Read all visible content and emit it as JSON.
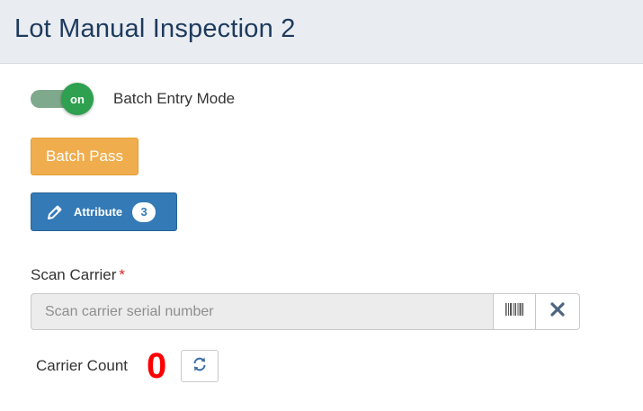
{
  "header": {
    "title": "Lot Manual Inspection 2"
  },
  "batch_mode": {
    "toggle_state": "on",
    "label": "Batch Entry Mode"
  },
  "actions": {
    "batch_pass_label": "Batch Pass",
    "attribute_label": "Attribute",
    "attribute_count": "3"
  },
  "scan": {
    "label": "Scan Carrier",
    "required_marker": "*",
    "value": "",
    "placeholder": "Scan carrier serial number",
    "barcode_icon": "barcode-icon",
    "clear_icon": "close-icon"
  },
  "carrier_count": {
    "label": "Carrier Count",
    "value": "0",
    "refresh_icon": "refresh-icon"
  },
  "colors": {
    "toggle_on": "#2ea04f",
    "batch_pass": "#f0ad4e",
    "attribute": "#337ab7",
    "count": "#ff0000",
    "required": "#e02424"
  }
}
